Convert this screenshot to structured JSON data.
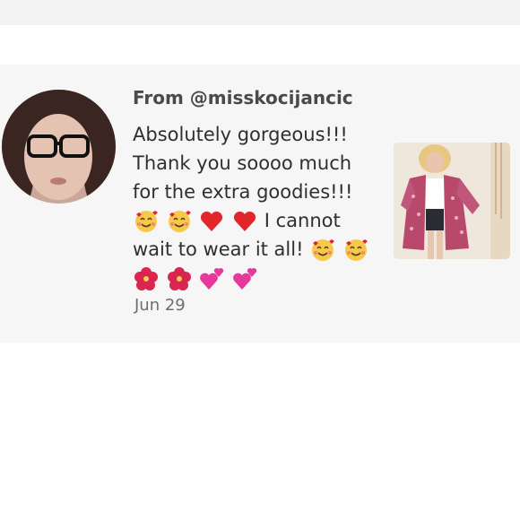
{
  "comment": {
    "from_label": "From @misskocijancic",
    "message_lines": [
      "Absolutely gorgeous!!!",
      "Thank you soooo much",
      "for the extra goodies!!!"
    ],
    "message_line_4_text": "I cannot",
    "message_line_5_text": "wait to wear it all!",
    "date": "Jun 29"
  },
  "emojis": {
    "line4": [
      "smiling-face-with-hearts",
      "smiling-face-with-hearts",
      "red-heart",
      "red-heart"
    ],
    "line5": [
      "smiling-face-with-hearts",
      "smiling-face-with-hearts"
    ],
    "line6": [
      "hibiscus",
      "hibiscus",
      "two-hearts",
      "two-hearts"
    ]
  },
  "colors": {
    "card_bg": "#f6f6f6",
    "heart_red": "#e0252b",
    "pink": "#e6399b"
  }
}
